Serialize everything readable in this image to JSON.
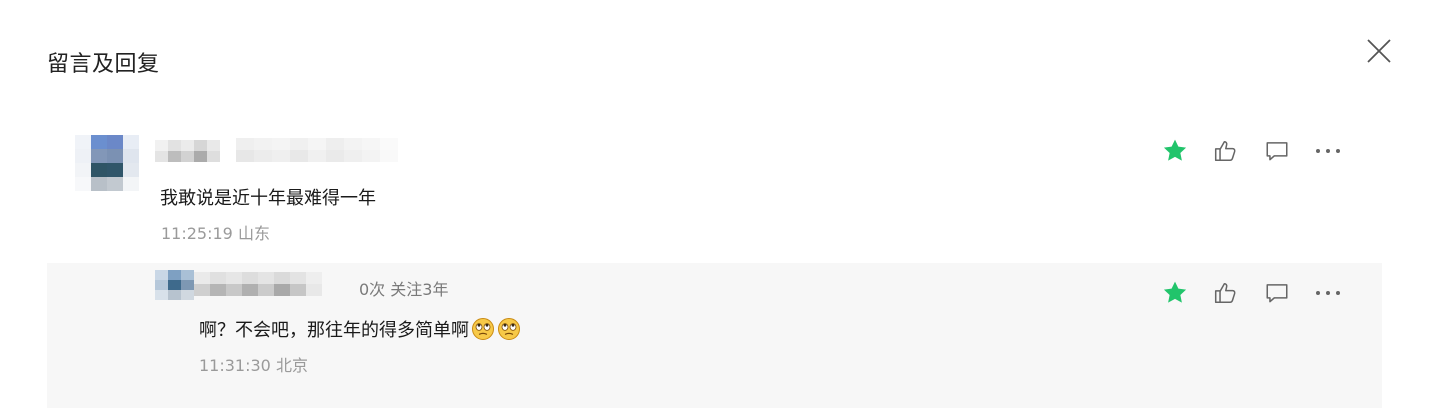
{
  "panel": {
    "title": "留言及回复"
  },
  "comments": [
    {
      "text": "我敢说是近十年最难得一年",
      "time": "11:25:19 山东",
      "starred": true
    }
  ],
  "reply": {
    "meta_visible": "0次 关注3年",
    "text": "啊？不会吧，那往年的得多简单啊",
    "emojis": [
      "eye-roll-emoji",
      "eye-roll-emoji"
    ],
    "time": "11:31:30 北京",
    "starred": true
  },
  "colors": {
    "star": "#21c46b",
    "icon": "#666666",
    "reply_bg": "#f7f7f7"
  },
  "icons": [
    "close-icon",
    "star-icon",
    "thumbs-up-icon",
    "comment-icon",
    "more-icon"
  ]
}
